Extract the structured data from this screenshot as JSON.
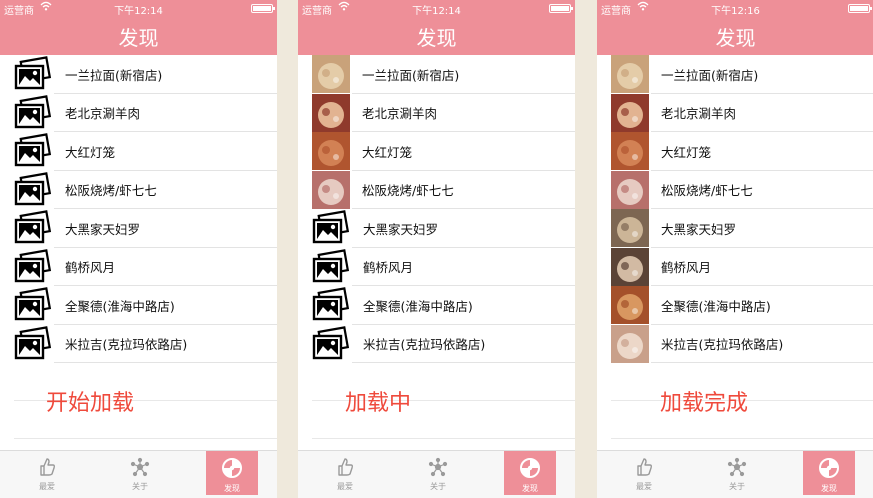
{
  "screens": [
    {
      "status": {
        "carrier": "运营商",
        "time": "下午12:14"
      },
      "title": "发现",
      "caption": "开始加载",
      "thumbs": [
        "placeholder",
        "placeholder",
        "placeholder",
        "placeholder",
        "placeholder",
        "placeholder",
        "placeholder",
        "placeholder"
      ]
    },
    {
      "status": {
        "carrier": "运营商",
        "time": "下午12:14"
      },
      "title": "发现",
      "caption": "加载中",
      "thumbs": [
        "photo",
        "photo",
        "photo",
        "photo",
        "placeholder",
        "placeholder",
        "placeholder",
        "placeholder"
      ]
    },
    {
      "status": {
        "carrier": "运营商",
        "time": "下午12:16"
      },
      "title": "发现",
      "caption": "加载完成",
      "thumbs": [
        "photo",
        "photo",
        "photo",
        "photo",
        "photo",
        "photo",
        "photo",
        "photo"
      ]
    }
  ],
  "restaurants": [
    "一兰拉面(新宿店)",
    "老北京涮羊肉",
    "大红灯笼",
    "松阪烧烤/虾七七",
    "大黑家天妇罗",
    "鹤桥风月",
    "全聚德(淮海中路店)",
    "米拉吉(克拉玛依路店)"
  ],
  "photo_colors": [
    "#c9a27a",
    "#8f3a2c",
    "#b0552f",
    "#b7706b",
    "#7d6652",
    "#5b4336",
    "#a4502a",
    "#c9a08a"
  ],
  "tabs": [
    {
      "label": "最爱",
      "icon": "thumbs-up-icon"
    },
    {
      "label": "关于",
      "icon": "network-icon"
    },
    {
      "label": "发现",
      "icon": "discover-icon"
    }
  ],
  "colors": {
    "accent": "#ee8f98",
    "caption": "#ef4a3c"
  }
}
